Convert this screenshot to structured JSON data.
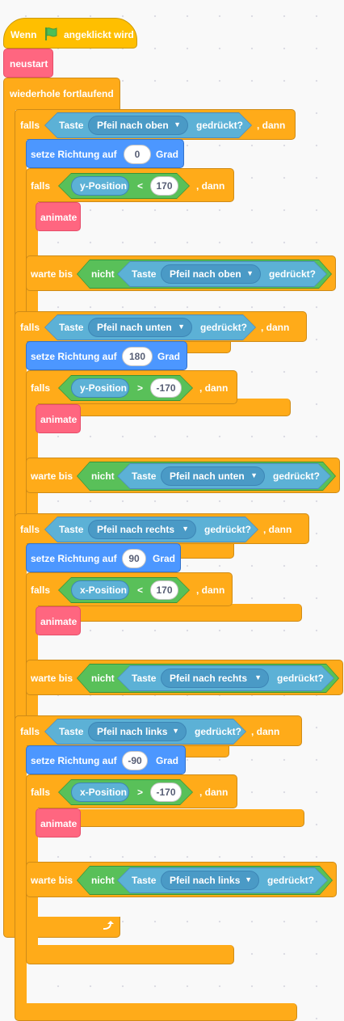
{
  "hat": {
    "prefix": "Wenn",
    "suffix": "angeklickt wird",
    "icon": "green-flag-icon"
  },
  "neustart": "neustart",
  "forever": {
    "label": "wiederhole fortlaufend",
    "icon": "loop-arrow-icon"
  },
  "colors": {
    "events": "#ffbf00",
    "control": "#ffab19",
    "motion": "#4c97ff",
    "custom": "#ff6680",
    "sensing": "#5cb1d6",
    "operators": "#59c059"
  },
  "groups": [
    {
      "if_label": "falls",
      "then_label": ", dann",
      "sensor": {
        "taste": "Taste",
        "key": "Pfeil nach oben",
        "pressed": "gedrückt?"
      },
      "direction": {
        "label": "setze Richtung auf",
        "value": "0",
        "unit": "Grad"
      },
      "inner_if": {
        "label": "falls",
        "reporter": "y-Position",
        "op": "<",
        "value": "170",
        "then": ", dann"
      },
      "animate": "animate",
      "wait": {
        "label": "warte bis",
        "not": "nicht",
        "taste": "Taste",
        "key": "Pfeil nach oben",
        "pressed": "gedrückt?"
      }
    },
    {
      "if_label": "falls",
      "then_label": ", dann",
      "sensor": {
        "taste": "Taste",
        "key": "Pfeil nach unten",
        "pressed": "gedrückt?"
      },
      "direction": {
        "label": "setze Richtung auf",
        "value": "180",
        "unit": "Grad"
      },
      "inner_if": {
        "label": "falls",
        "reporter": "y-Position",
        "op": ">",
        "value": "-170",
        "then": ", dann"
      },
      "animate": "animate",
      "wait": {
        "label": "warte bis",
        "not": "nicht",
        "taste": "Taste",
        "key": "Pfeil nach unten",
        "pressed": "gedrückt?"
      }
    },
    {
      "if_label": "falls",
      "then_label": ", dann",
      "sensor": {
        "taste": "Taste",
        "key": "Pfeil nach rechts",
        "pressed": "gedrückt?"
      },
      "direction": {
        "label": "setze Richtung auf",
        "value": "90",
        "unit": "Grad"
      },
      "inner_if": {
        "label": "falls",
        "reporter": "x-Position",
        "op": "<",
        "value": "170",
        "then": ", dann"
      },
      "animate": "animate",
      "wait": {
        "label": "warte bis",
        "not": "nicht",
        "taste": "Taste",
        "key": "Pfeil nach rechts",
        "pressed": "gedrückt?"
      }
    },
    {
      "if_label": "falls",
      "then_label": ", dann",
      "sensor": {
        "taste": "Taste",
        "key": "Pfeil nach links",
        "pressed": "gedrückt?"
      },
      "direction": {
        "label": "setze Richtung auf",
        "value": "-90",
        "unit": "Grad"
      },
      "inner_if": {
        "label": "falls",
        "reporter": "x-Position",
        "op": ">",
        "value": "-170",
        "then": ", dann"
      },
      "animate": "animate",
      "wait": {
        "label": "warte bis",
        "not": "nicht",
        "taste": "Taste",
        "key": "Pfeil nach links",
        "pressed": "gedrückt?"
      }
    }
  ]
}
